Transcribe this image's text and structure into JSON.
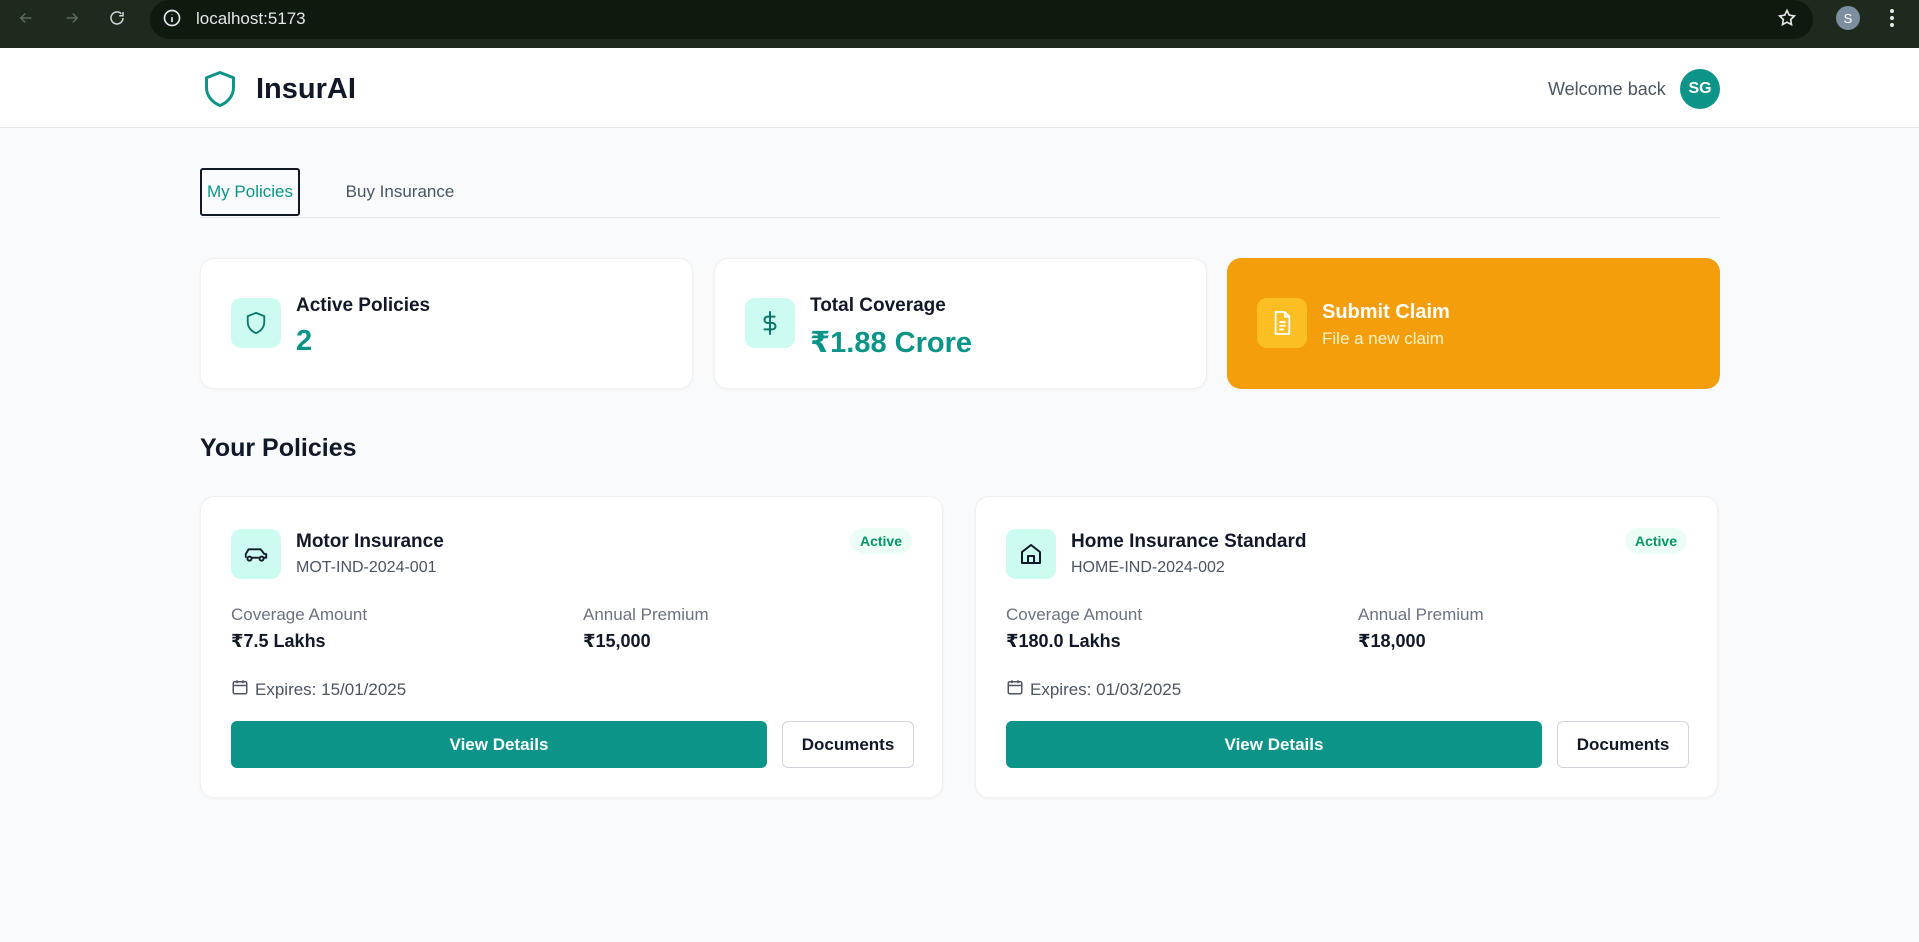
{
  "browser": {
    "url": "localhost:5173",
    "profile_initial": "S"
  },
  "header": {
    "brand": "InsurAI",
    "welcome": "Welcome back",
    "avatar_initials": "SG"
  },
  "tabs": [
    {
      "label": "My Policies",
      "active": true
    },
    {
      "label": "Buy Insurance",
      "active": false
    }
  ],
  "stats": {
    "active_policies": {
      "label": "Active Policies",
      "value": "2",
      "icon": "shield-icon"
    },
    "total_coverage": {
      "label": "Total Coverage",
      "value": "₹1.88 Crore",
      "icon": "dollar-icon"
    },
    "submit_claim": {
      "title": "Submit Claim",
      "subtitle": "File a new claim",
      "icon": "document-icon"
    }
  },
  "section_title": "Your Policies",
  "policies": [
    {
      "name": "Motor Insurance",
      "id": "MOT-IND-2024-001",
      "status": "Active",
      "icon": "car-icon",
      "coverage_label": "Coverage Amount",
      "coverage_value": "₹7.5 Lakhs",
      "premium_label": "Annual Premium",
      "premium_value": "₹15,000",
      "expires": "Expires: 15/01/2025",
      "view_label": "View Details",
      "docs_label": "Documents"
    },
    {
      "name": "Home Insurance Standard",
      "id": "HOME-IND-2024-002",
      "status": "Active",
      "icon": "home-icon",
      "coverage_label": "Coverage Amount",
      "coverage_value": "₹180.0 Lakhs",
      "premium_label": "Annual Premium",
      "premium_value": "₹18,000",
      "expires": "Expires: 01/03/2025",
      "view_label": "View Details",
      "docs_label": "Documents"
    }
  ],
  "colors": {
    "primary": "#0d9488",
    "claim": "#f59e0b",
    "badge_text": "#059669"
  }
}
